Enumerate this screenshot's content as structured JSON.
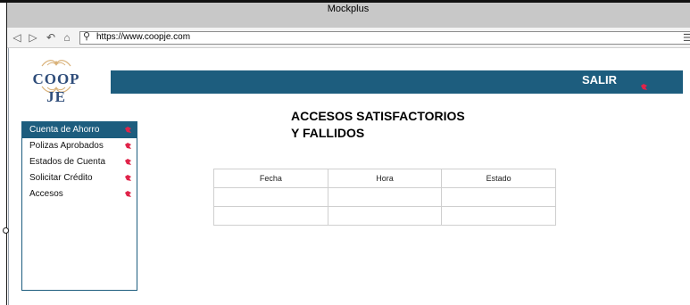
{
  "window": {
    "title": "Mockplus"
  },
  "browser": {
    "url": "https://www.coopje.com",
    "icons": [
      "back-icon",
      "forward-icon",
      "refresh-icon",
      "home-icon",
      "search-icon",
      "menu-icon"
    ]
  },
  "logo": {
    "text": "COOP JE"
  },
  "header": {
    "logout_label": "SALIR"
  },
  "sidebar": {
    "items": [
      {
        "label": "Cuenta de Ahorro",
        "active": true
      },
      {
        "label": "Polizas Aprobados",
        "active": false
      },
      {
        "label": "Estados de Cuenta",
        "active": false
      },
      {
        "label": "Solicitar Crédito",
        "active": false
      },
      {
        "label": "Accesos",
        "active": false
      }
    ]
  },
  "main": {
    "heading_line1": "ACCESOS SATISFACTORIOS",
    "heading_line2": "Y FALLIDOS",
    "table": {
      "columns": [
        "Fecha",
        "Hora",
        "Estado"
      ],
      "rows": [
        [
          "",
          "",
          ""
        ],
        [
          "",
          "",
          ""
        ]
      ]
    }
  },
  "colors": {
    "brand": "#1d5d7e",
    "icon_red": "#e0244a",
    "logo_text": "#2f4d7a",
    "logo_ornament": "#d9b27a"
  }
}
